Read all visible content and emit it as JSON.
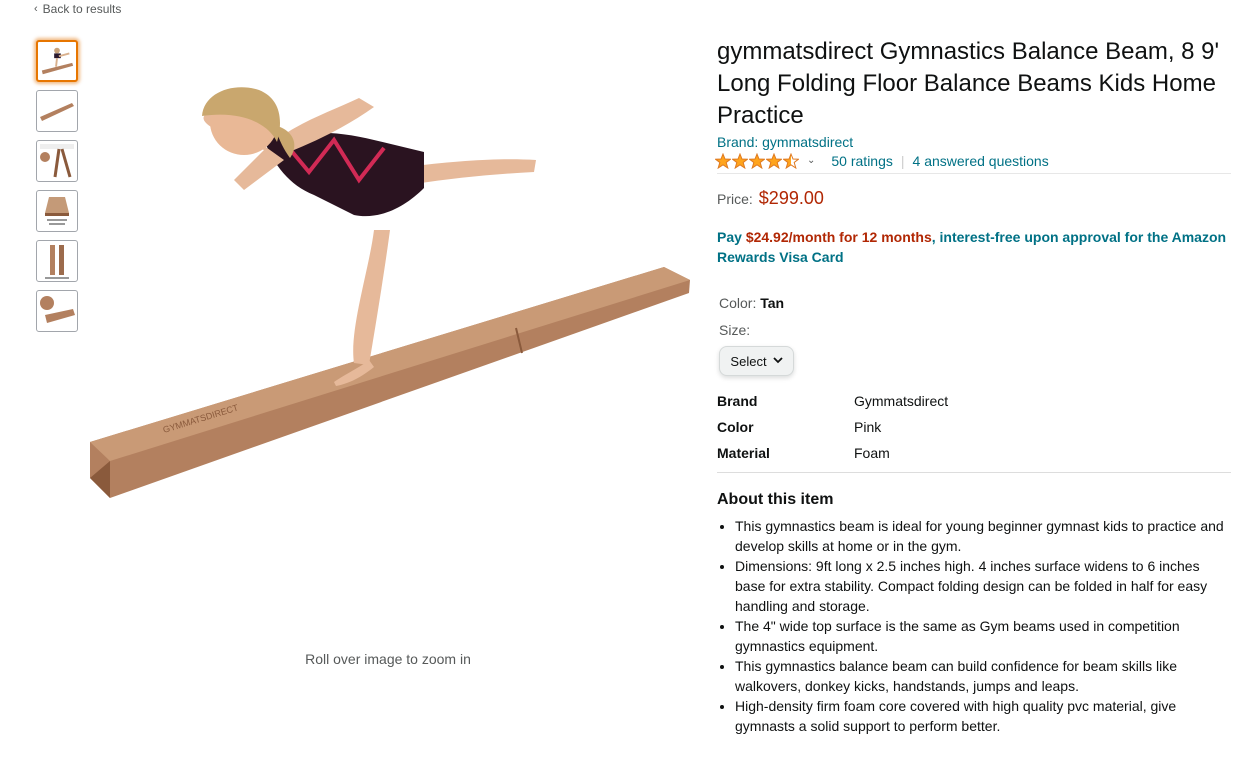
{
  "nav": {
    "back_label": "Back to results",
    "back_chevron": "‹"
  },
  "gallery": {
    "zoom_hint": "Roll over image to zoom in",
    "thumbnails": [
      "gymnast-on-beam",
      "beam-side-view",
      "beam-folded-diagram",
      "beam-dimensions-diagram",
      "beam-length-diagram",
      "beam-end-view"
    ]
  },
  "product": {
    "title": "gymmatsdirect Gymnastics Balance Beam, 8 9' Long Folding Floor Balance Beams Kids Home Practice",
    "brand_link": "Brand: gymmatsdirect",
    "rating": 4.5,
    "rating_caret": "⌄",
    "ratings_count": "50 ratings",
    "separator": "|",
    "answered_questions": "4 answered questions",
    "price_label": "Price:",
    "price": "$299.00",
    "finance_prefix": "Pay ",
    "finance_amount": "$24.92/month for 12 months",
    "finance_suffix": ", interest-free upon approval for the Amazon Rewards Visa Card",
    "color_label": "Color: ",
    "color_value": "Tan",
    "size_label": "Size:",
    "size_select": "Select",
    "attributes": [
      {
        "key": "Brand",
        "value": "Gymmatsdirect"
      },
      {
        "key": "Color",
        "value": "Pink"
      },
      {
        "key": "Material",
        "value": "Foam"
      }
    ],
    "about_title": "About this item",
    "bullets": [
      "This gymnastics beam is ideal for young beginner gymnast kids to practice and develop skills at home or in the gym.",
      "Dimensions: 9ft long x 2.5 inches high. 4 inches surface widens to 6 inches base for extra stability. Compact folding design can be folded in half for easy handling and storage.",
      "The 4\" wide top surface is the same as Gym beams used in competition gymnastics equipment.",
      "This gymnastics balance beam can build confidence for beam skills like walkovers, donkey kicks, handstands, jumps and leaps.",
      "High-density firm foam core covered with high quality pvc material, give gymnasts a solid support to perform better."
    ]
  },
  "colors": {
    "link": "#007185",
    "price": "#b12704",
    "star": "#ffa41c",
    "beam": "#b3805f"
  }
}
